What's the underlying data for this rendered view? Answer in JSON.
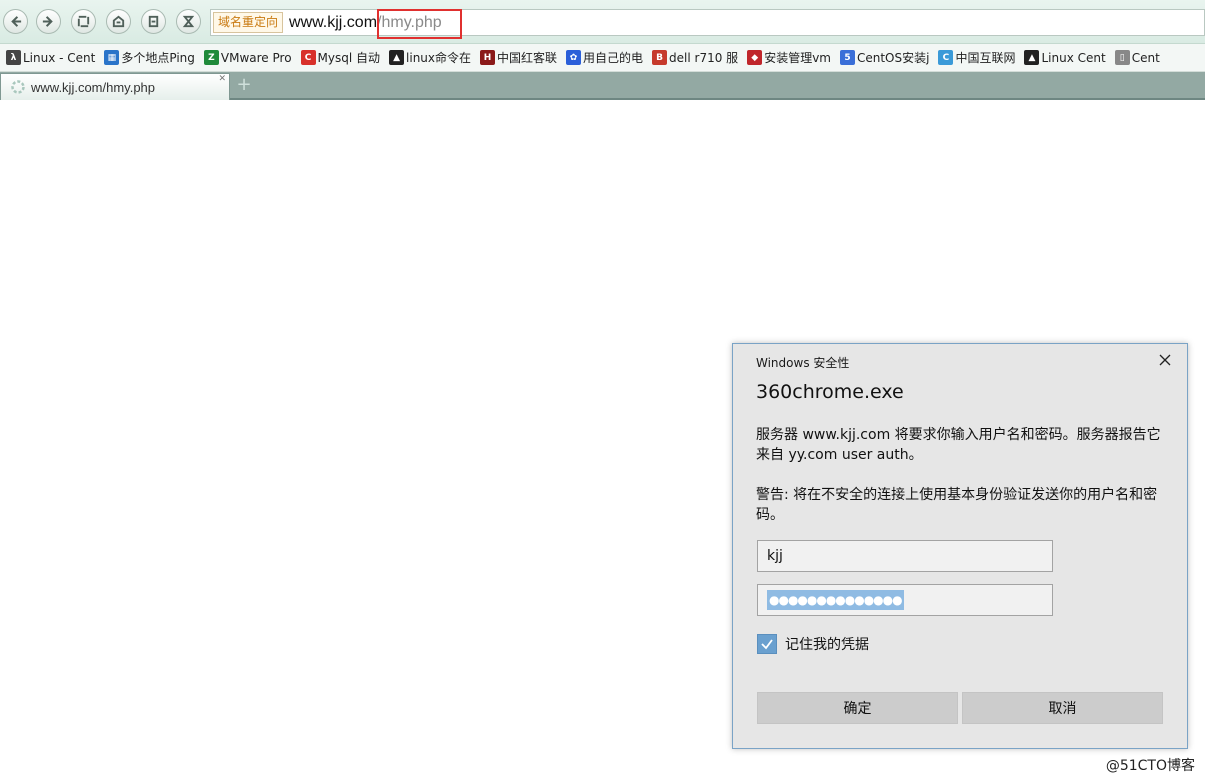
{
  "address_bar": {
    "redirect_tag": "域名重定向",
    "url_host": "www.kjj.com",
    "url_path": "/hmy.php"
  },
  "bookmarks": [
    {
      "label": "Linux - Cent",
      "icon": "linux-icon",
      "color": "#444444"
    },
    {
      "label": "多个地点Ping",
      "icon": "ping-icon",
      "color": "#2a74c9"
    },
    {
      "label": "VMware Pro",
      "icon": "vmware-icon",
      "color": "#1f8a3a"
    },
    {
      "label": "Mysql 自动",
      "icon": "c-icon",
      "color": "#d8312b"
    },
    {
      "label": "linux命令在",
      "icon": "tux-icon",
      "color": "#222222"
    },
    {
      "label": "中国红客联",
      "icon": "huc-icon",
      "color": "#8b1a1a"
    },
    {
      "label": "用自己的电",
      "icon": "paw-icon",
      "color": "#2b5fd9"
    },
    {
      "label": "dell r710 服",
      "icon": "b-icon",
      "color": "#c63a2c"
    },
    {
      "label": "安装管理vm",
      "icon": "shield-icon",
      "color": "#c0262b"
    },
    {
      "label": "CentOS安装j",
      "icon": "51-icon",
      "color": "#3a6fd8"
    },
    {
      "label": "中国互联网",
      "icon": "c-outline-icon",
      "color": "#3a9ad8"
    },
    {
      "label": "Linux Cent",
      "icon": "tux-icon",
      "color": "#222222"
    },
    {
      "label": "Cent",
      "icon": "page-icon",
      "color": "#888888"
    }
  ],
  "tab": {
    "label": "www.kjj.com/hmy.php"
  },
  "dialog": {
    "header": "Windows 安全性",
    "app_name": "360chrome.exe",
    "message": "服务器 www.kjj.com 将要求你输入用户名和密码。服务器报告它来自 yy.com user auth。",
    "warning": "警告: 将在不安全的连接上使用基本身份验证发送你的用户名和密码。",
    "username": "kjj",
    "password_masked": "●●●●●●●●●●●●●●",
    "remember_label": "记住我的凭据",
    "remember_checked": true,
    "ok_label": "确定",
    "cancel_label": "取消"
  },
  "watermark": "@51CTO博客",
  "colors": {
    "dialog_border": "#7aa3c6",
    "highlight_box": "#e0302f",
    "checkbox": "#6aa0cf"
  }
}
